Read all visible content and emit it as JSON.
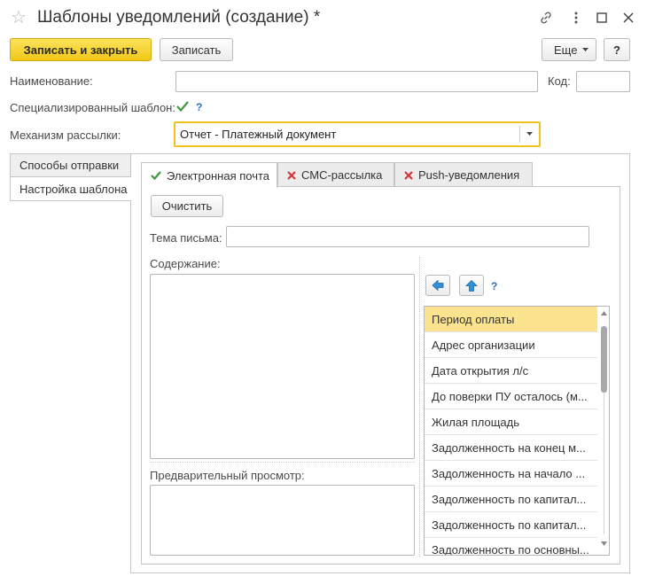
{
  "window": {
    "title": "Шаблоны уведомлений (создание) *"
  },
  "toolbar": {
    "save_close_label": "Записать и закрыть",
    "save_label": "Записать",
    "more_label": "Еще",
    "help_label": "?"
  },
  "form": {
    "name_label": "Наименование:",
    "name_value": "",
    "code_label": "Код:",
    "code_value": "",
    "specialized_label": "Специализированный шаблон:",
    "specialized_checked": true,
    "specialized_help": "?",
    "mechanism_label": "Механизм рассылки:",
    "mechanism_value": "Отчет - Платежный документ"
  },
  "side_tabs": [
    {
      "label": "Способы отправки"
    },
    {
      "label": "Настройка шаблона"
    }
  ],
  "tabs": [
    {
      "label": "Электронная почта",
      "status": "check"
    },
    {
      "label": "СМС-рассылка",
      "status": "cross"
    },
    {
      "label": "Push-уведомления",
      "status": "cross"
    }
  ],
  "email_tab": {
    "clear_label": "Очистить",
    "subject_label": "Тема письма:",
    "subject_value": "",
    "content_label": "Содержание:",
    "preview_label": "Предварительный просмотр:",
    "params_help": "?"
  },
  "params_list": [
    "Период оплаты",
    "Адрес организации",
    "Дата открытия л/с",
    "До поверки ПУ осталось (м...",
    "Жилая площадь",
    "Задолженность на конец м...",
    "Задолженность на начало ...",
    "Задолженность по капитал...",
    "Задолженность по капитал...",
    "Задолженность по основны..."
  ],
  "colors": {
    "accent_yellow": "#f5d02a",
    "focus_border": "#f0c11f",
    "selected_row": "#fce48e",
    "check_green": "#3a9a3a",
    "cross_red": "#d8353b",
    "nav_arrow_blue": "#2f8fd8"
  },
  "icons": {
    "favorite": "star-outline-icon",
    "link": "link-icon",
    "menu": "vertical-dots-icon",
    "maximize": "square-icon",
    "close": "close-icon"
  }
}
